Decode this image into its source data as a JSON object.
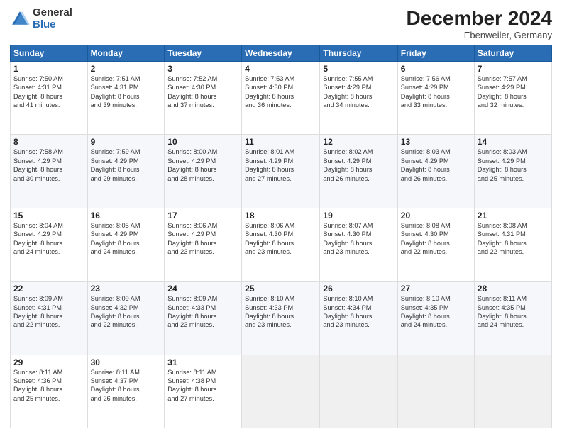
{
  "logo": {
    "general": "General",
    "blue": "Blue"
  },
  "header": {
    "month": "December 2024",
    "location": "Ebenweiler, Germany"
  },
  "weekdays": [
    "Sunday",
    "Monday",
    "Tuesday",
    "Wednesday",
    "Thursday",
    "Friday",
    "Saturday"
  ],
  "weeks": [
    [
      {
        "day": "1",
        "info": "Sunrise: 7:50 AM\nSunset: 4:31 PM\nDaylight: 8 hours\nand 41 minutes."
      },
      {
        "day": "2",
        "info": "Sunrise: 7:51 AM\nSunset: 4:31 PM\nDaylight: 8 hours\nand 39 minutes."
      },
      {
        "day": "3",
        "info": "Sunrise: 7:52 AM\nSunset: 4:30 PM\nDaylight: 8 hours\nand 37 minutes."
      },
      {
        "day": "4",
        "info": "Sunrise: 7:53 AM\nSunset: 4:30 PM\nDaylight: 8 hours\nand 36 minutes."
      },
      {
        "day": "5",
        "info": "Sunrise: 7:55 AM\nSunset: 4:29 PM\nDaylight: 8 hours\nand 34 minutes."
      },
      {
        "day": "6",
        "info": "Sunrise: 7:56 AM\nSunset: 4:29 PM\nDaylight: 8 hours\nand 33 minutes."
      },
      {
        "day": "7",
        "info": "Sunrise: 7:57 AM\nSunset: 4:29 PM\nDaylight: 8 hours\nand 32 minutes."
      }
    ],
    [
      {
        "day": "8",
        "info": "Sunrise: 7:58 AM\nSunset: 4:29 PM\nDaylight: 8 hours\nand 30 minutes."
      },
      {
        "day": "9",
        "info": "Sunrise: 7:59 AM\nSunset: 4:29 PM\nDaylight: 8 hours\nand 29 minutes."
      },
      {
        "day": "10",
        "info": "Sunrise: 8:00 AM\nSunset: 4:29 PM\nDaylight: 8 hours\nand 28 minutes."
      },
      {
        "day": "11",
        "info": "Sunrise: 8:01 AM\nSunset: 4:29 PM\nDaylight: 8 hours\nand 27 minutes."
      },
      {
        "day": "12",
        "info": "Sunrise: 8:02 AM\nSunset: 4:29 PM\nDaylight: 8 hours\nand 26 minutes."
      },
      {
        "day": "13",
        "info": "Sunrise: 8:03 AM\nSunset: 4:29 PM\nDaylight: 8 hours\nand 26 minutes."
      },
      {
        "day": "14",
        "info": "Sunrise: 8:03 AM\nSunset: 4:29 PM\nDaylight: 8 hours\nand 25 minutes."
      }
    ],
    [
      {
        "day": "15",
        "info": "Sunrise: 8:04 AM\nSunset: 4:29 PM\nDaylight: 8 hours\nand 24 minutes."
      },
      {
        "day": "16",
        "info": "Sunrise: 8:05 AM\nSunset: 4:29 PM\nDaylight: 8 hours\nand 24 minutes."
      },
      {
        "day": "17",
        "info": "Sunrise: 8:06 AM\nSunset: 4:29 PM\nDaylight: 8 hours\nand 23 minutes."
      },
      {
        "day": "18",
        "info": "Sunrise: 8:06 AM\nSunset: 4:30 PM\nDaylight: 8 hours\nand 23 minutes."
      },
      {
        "day": "19",
        "info": "Sunrise: 8:07 AM\nSunset: 4:30 PM\nDaylight: 8 hours\nand 23 minutes."
      },
      {
        "day": "20",
        "info": "Sunrise: 8:08 AM\nSunset: 4:30 PM\nDaylight: 8 hours\nand 22 minutes."
      },
      {
        "day": "21",
        "info": "Sunrise: 8:08 AM\nSunset: 4:31 PM\nDaylight: 8 hours\nand 22 minutes."
      }
    ],
    [
      {
        "day": "22",
        "info": "Sunrise: 8:09 AM\nSunset: 4:31 PM\nDaylight: 8 hours\nand 22 minutes."
      },
      {
        "day": "23",
        "info": "Sunrise: 8:09 AM\nSunset: 4:32 PM\nDaylight: 8 hours\nand 22 minutes."
      },
      {
        "day": "24",
        "info": "Sunrise: 8:09 AM\nSunset: 4:33 PM\nDaylight: 8 hours\nand 23 minutes."
      },
      {
        "day": "25",
        "info": "Sunrise: 8:10 AM\nSunset: 4:33 PM\nDaylight: 8 hours\nand 23 minutes."
      },
      {
        "day": "26",
        "info": "Sunrise: 8:10 AM\nSunset: 4:34 PM\nDaylight: 8 hours\nand 23 minutes."
      },
      {
        "day": "27",
        "info": "Sunrise: 8:10 AM\nSunset: 4:35 PM\nDaylight: 8 hours\nand 24 minutes."
      },
      {
        "day": "28",
        "info": "Sunrise: 8:11 AM\nSunset: 4:35 PM\nDaylight: 8 hours\nand 24 minutes."
      }
    ],
    [
      {
        "day": "29",
        "info": "Sunrise: 8:11 AM\nSunset: 4:36 PM\nDaylight: 8 hours\nand 25 minutes."
      },
      {
        "day": "30",
        "info": "Sunrise: 8:11 AM\nSunset: 4:37 PM\nDaylight: 8 hours\nand 26 minutes."
      },
      {
        "day": "31",
        "info": "Sunrise: 8:11 AM\nSunset: 4:38 PM\nDaylight: 8 hours\nand 27 minutes."
      },
      null,
      null,
      null,
      null
    ]
  ]
}
